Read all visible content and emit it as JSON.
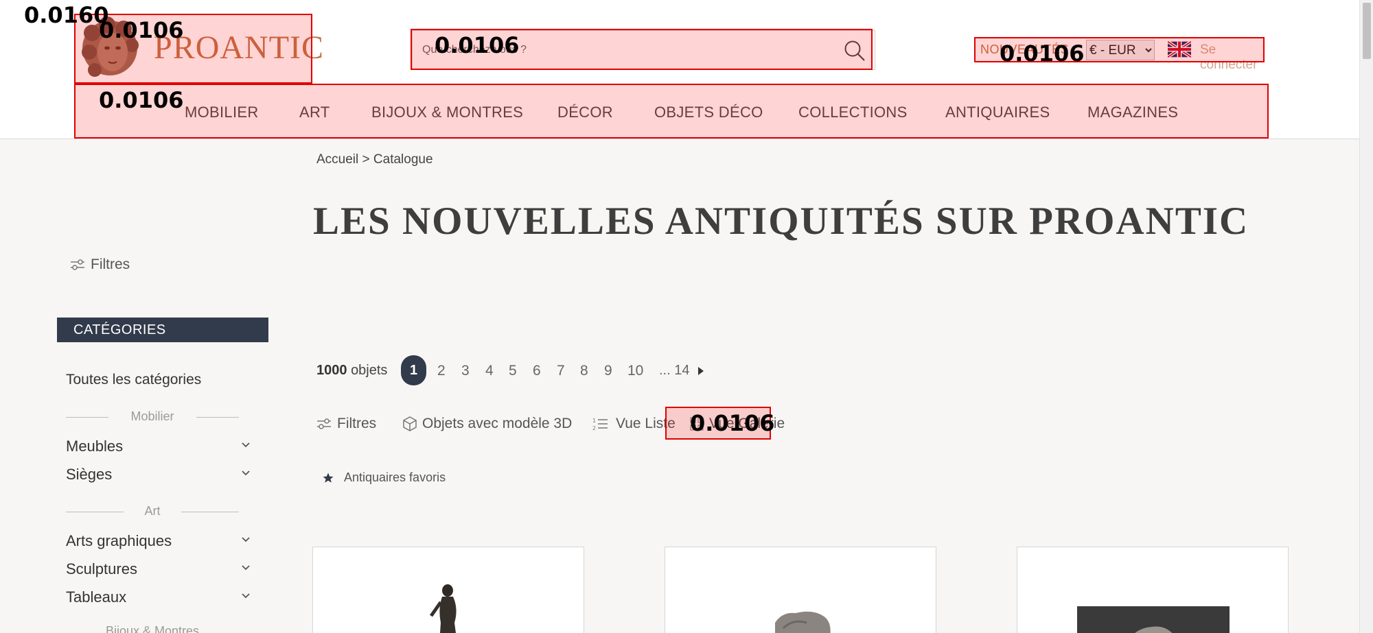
{
  "header": {
    "logo_text": "PROANTIC",
    "search_placeholder": "Que cherchez-vous ?",
    "nouveautes": "NOUVEAUTÉS",
    "currency": "€ - EUR",
    "login": "Se connecter"
  },
  "nav": [
    "MOBILIER",
    "ART",
    "BIJOUX & MONTRES",
    "DÉCOR",
    "OBJETS DÉCO",
    "COLLECTIONS",
    "ANTIQUAIRES",
    "MAGAZINES"
  ],
  "breadcrumb": "Accueil > Catalogue",
  "page_title": "LES NOUVELLES ANTIQUITÉS SUR PROANTIC",
  "sidebar": {
    "filters_label": "Filtres",
    "categories_header": "CATÉGORIES",
    "all_categories": "Toutes les catégories",
    "groups": [
      {
        "title": "Mobilier",
        "items": [
          "Meubles",
          "Sièges"
        ]
      },
      {
        "title": "Art",
        "items": [
          "Arts graphiques",
          "Sculptures",
          "Tableaux"
        ]
      },
      {
        "title": "Bijoux & Montres",
        "items": []
      }
    ]
  },
  "listing": {
    "count_number": "1000",
    "count_label": "objets",
    "pages": [
      "1",
      "2",
      "3",
      "4",
      "5",
      "6",
      "7",
      "8",
      "9",
      "10",
      "... 14"
    ],
    "current_page": "1",
    "filters_label": "Filtres",
    "objects_3d_label": "Objets avec modèle 3D",
    "list_view_label": "Vue Liste",
    "gallery_view_label": "Vue Galerie",
    "favorites_label": "Antiquaires favoris"
  },
  "overlay_scores": [
    "0.0160",
    "0.0106",
    "0.0106",
    "0.0106",
    "0.0106",
    "0.0106"
  ],
  "colors": {
    "brand": "#c2744a",
    "dark_navy": "#323b4b",
    "overlay_red": "#e00000",
    "background": "#f7f6f4"
  }
}
